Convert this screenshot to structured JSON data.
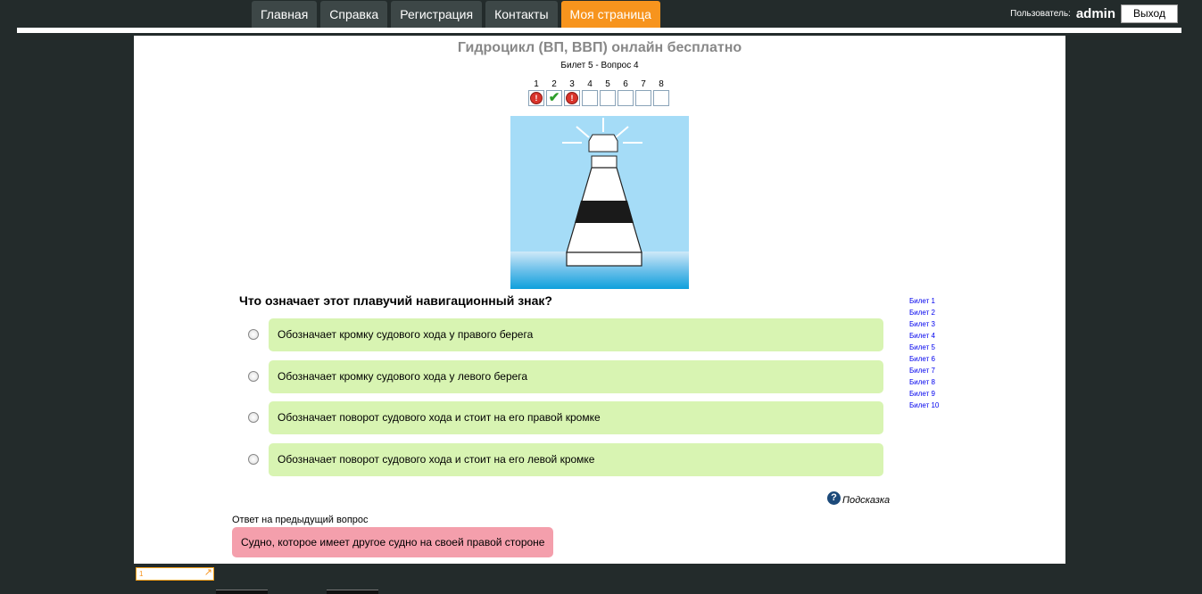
{
  "nav": {
    "tabs": [
      {
        "label": "Главная"
      },
      {
        "label": "Справка"
      },
      {
        "label": "Регистрация"
      },
      {
        "label": "Контакты"
      },
      {
        "label": "Моя страница",
        "active": true
      }
    ]
  },
  "user": {
    "label": "Пользователь:",
    "name": "admin",
    "logout_label": "Выход"
  },
  "quiz": {
    "title": "Гидроцикл (ВП, ВВП) онлайн бесплатно",
    "ticket_info": "Билет 5 - Вопрос 4",
    "progress": [
      {
        "num": "1",
        "status": "wrong"
      },
      {
        "num": "2",
        "status": "correct"
      },
      {
        "num": "3",
        "status": "wrong"
      },
      {
        "num": "4",
        "status": "empty"
      },
      {
        "num": "5",
        "status": "empty"
      },
      {
        "num": "6",
        "status": "empty"
      },
      {
        "num": "7",
        "status": "empty"
      },
      {
        "num": "8",
        "status": "empty"
      }
    ],
    "question": "Что означает этот плавучий навигационный знак?",
    "options": [
      "Обозначает кромку судового хода у правого берега",
      "Обозначает кромку судового хода у левого берега",
      "Обозначает поворот судового хода и стоит на его правой кромке",
      "Обозначает поворот судового хода и стоит на его левой кромке"
    ],
    "hint_label": "Подсказка",
    "prev_label": "Ответ на предыдущий вопрос",
    "prev_answer": "Судно, которое имеет другое судно на своей правой стороне"
  },
  "tickets": [
    "Билет 1",
    "Билет 2",
    "Билет 3",
    "Билет 4",
    "Билет 5",
    "Билет 6",
    "Билет 7",
    "Билет 8",
    "Билет 9",
    "Билет 10"
  ],
  "pager": {
    "current": "1"
  },
  "colors": {
    "background": "#232b2b",
    "nav_tab": "#3d4747",
    "nav_active": "#f7941d",
    "option_bg": "#d8f4b2",
    "prev_answer_bg": "#f49fac",
    "link": "#0000ee"
  }
}
